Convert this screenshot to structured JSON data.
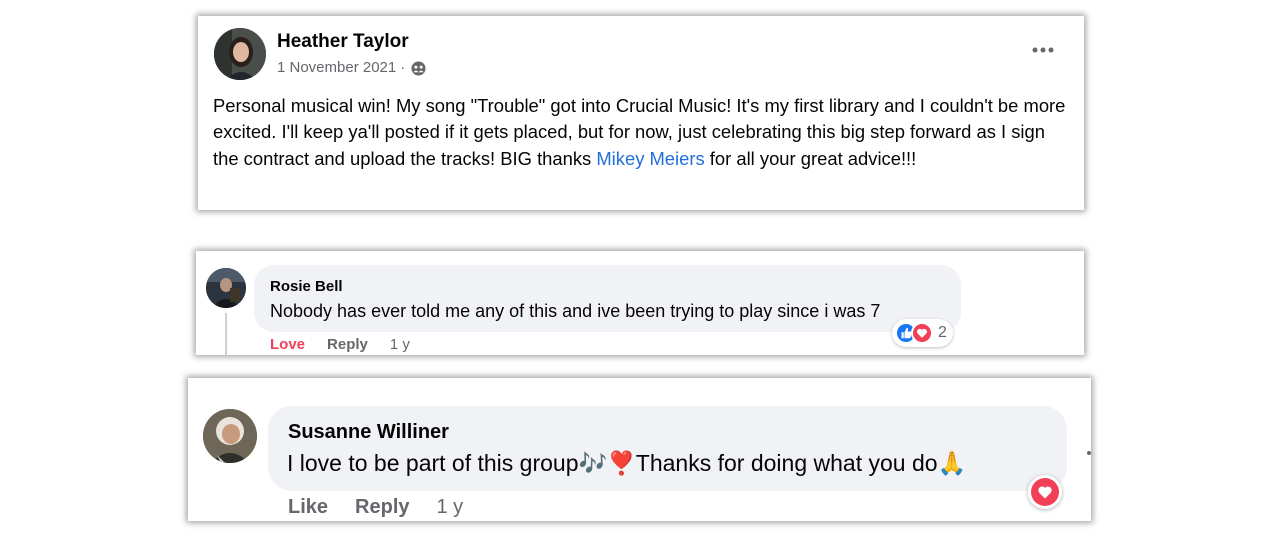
{
  "post": {
    "author": "Heather Taylor",
    "date": "1 November 2021",
    "separator": "·",
    "more_label": "•••",
    "text_before_mention": "Personal musical win! My song \"Trouble\" got into Crucial Music!  It's my first library and I couldn't be more excited. I'll keep ya'll posted if it gets placed, but for now, just celebrating this big step forward as I sign the contract and upload the tracks! BIG thanks ",
    "mention": "Mikey Meiers",
    "text_after_mention": " for all your great advice!!!",
    "icons": {
      "privacy": "group-audience-icon",
      "more": "more-options-icon"
    }
  },
  "comment1": {
    "author": "Rosie Bell",
    "text": "Nobody has ever told me any of this and ive been trying to play since i was 7",
    "reaction_count": "2",
    "actions": {
      "love": "Love",
      "reply": "Reply",
      "time": "1 y"
    },
    "icons": [
      "like-reaction-icon",
      "love-reaction-icon"
    ]
  },
  "comment2": {
    "author": "Susanne Williner",
    "text": "I love to be part of this group🎶❣️Thanks for doing what you do🙏",
    "actions": {
      "like": "Like",
      "reply": "Reply",
      "time": "1 y"
    },
    "icons": [
      "love-reaction-icon"
    ]
  },
  "colors": {
    "mention": "#216fdb",
    "love": "#f33e58",
    "like": "#1877f2",
    "bubble": "#f0f2f5",
    "secondary_text": "#65676b"
  }
}
